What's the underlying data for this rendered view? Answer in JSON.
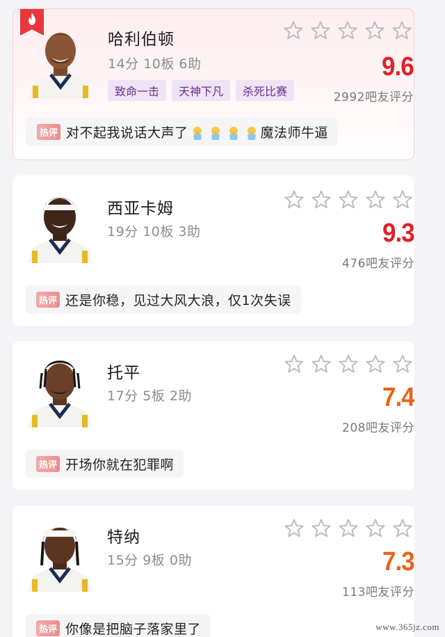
{
  "players": [
    {
      "name": "哈利伯顿",
      "stats": "14分 10板 6助",
      "tags": [
        "致命一击",
        "天神下凡",
        "杀死比赛"
      ],
      "score": "9.6",
      "score_color": "#e0202a",
      "votes": "2992吧友评分",
      "comment_badge": "热评",
      "comment_before": "对不起我说话大声了",
      "comment_emoji": "praying-hands",
      "comment_after": "魔法师牛逼",
      "featured": true
    },
    {
      "name": "西亚卡姆",
      "stats": "19分 10板 3助",
      "tags": [],
      "score": "9.3",
      "score_color": "#e0202a",
      "votes": "476吧友评分",
      "comment_badge": "热评",
      "comment_before": "还是你稳，见过大风大浪，仅1次失误",
      "comment_after": ""
    },
    {
      "name": "托平",
      "stats": "17分 5板 2助",
      "tags": [],
      "score": "7.4",
      "score_color": "#e8631a",
      "votes": "208吧友评分",
      "comment_badge": "热评",
      "comment_before": "开场你就在犯罪啊",
      "comment_after": ""
    },
    {
      "name": "特纳",
      "stats": "15分 9板 0助",
      "tags": [],
      "score": "7.3",
      "score_color": "#e8631a",
      "votes": "113吧友评分",
      "comment_badge": "热评",
      "comment_before": "你像是把脑子落家里了",
      "comment_after": ""
    }
  ],
  "watermark": "www.365jz.com",
  "icons": {
    "ribbon": "flame-icon",
    "star": "star-outline-icon"
  }
}
